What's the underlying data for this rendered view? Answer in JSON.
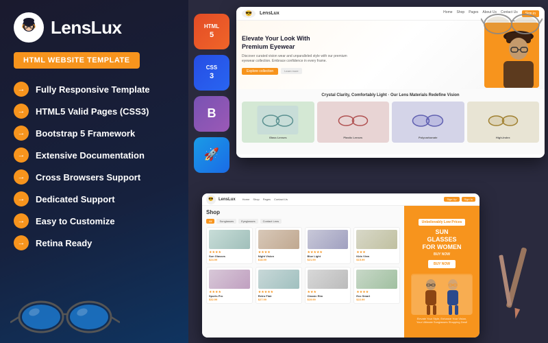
{
  "brand": {
    "name": "LensLux",
    "logo_char": "😎"
  },
  "badge": {
    "label": "HTML WEBSITE TEMPLATE"
  },
  "features": [
    {
      "id": "responsive",
      "text": "Fully Responsive Template"
    },
    {
      "id": "html5",
      "text": "HTML5 Valid Pages (CSS3)"
    },
    {
      "id": "bootstrap",
      "text": "Bootstrap 5 Framework"
    },
    {
      "id": "docs",
      "text": "Extensive Documentation"
    },
    {
      "id": "crossbrowser",
      "text": "Cross Browsers Support"
    },
    {
      "id": "support",
      "text": "Dedicated Support"
    },
    {
      "id": "customize",
      "text": "Easy to Customize"
    },
    {
      "id": "retina",
      "text": "Retina Ready"
    }
  ],
  "tech_badges": [
    {
      "id": "html5",
      "label": "HTML\n5",
      "class": "tech-html"
    },
    {
      "id": "css3",
      "label": "CSS\n3",
      "class": "tech-css"
    },
    {
      "id": "bootstrap5",
      "label": "B",
      "class": "tech-bootstrap"
    },
    {
      "id": "rocket",
      "label": "🚀",
      "class": "tech-rocket"
    }
  ],
  "mockup_top": {
    "nav": {
      "logo": "LensLux",
      "links": [
        "Home",
        "Shop",
        "Pages",
        "About Us",
        "Contact Us"
      ],
      "btn_label": "Sign in"
    },
    "hero": {
      "title": "Elevate Your Look With\nPremium Eyewear",
      "subtitle": "Discover curated vision wear and unparalleled style with our premium eyewear collection. Embrace confidence in every frame.",
      "btn_label": "Explore collection"
    },
    "products_title": "Crystal Clarity, Comfortably Light - Our Lens\nMaterials Redefine Vision",
    "product_labels": [
      "Glass Lenses",
      "Plastic Lenses",
      "Polycarbonate Lenses",
      "High-Index Lenses"
    ]
  },
  "mockup_bottom": {
    "nav": {
      "logo": "LensLux",
      "links": [
        "Home",
        "Shop",
        "Pages",
        "Contact Us"
      ],
      "btn1": "Sign Up",
      "btn2": "Sign In"
    },
    "shop_title": "Shop",
    "filters": [
      "All",
      "Sunglasses",
      "Eyeglasses",
      "Contact Lens"
    ],
    "items": [
      {
        "name": "Sun Glasses",
        "price": "$24.99",
        "stars": "★★★★"
      },
      {
        "name": "Night Vision",
        "price": "$18.99",
        "stars": "★★★★"
      },
      {
        "name": "Blue Light",
        "price": "$21.99",
        "stars": "★★★★★"
      },
      {
        "name": "Kids View",
        "price": "$15.99",
        "stars": "★★★"
      },
      {
        "name": "Sports Pro",
        "price": "$32.99",
        "stars": "★★★★"
      },
      {
        "name": "Retro Flair",
        "price": "$27.99",
        "stars": "★★★★★"
      },
      {
        "name": "Classic Rim",
        "price": "$19.99",
        "stars": "★★★"
      },
      {
        "name": "Eco Smart",
        "price": "$22.99",
        "stars": "★★★★"
      }
    ],
    "ad": {
      "badge": "Unbelievably Low Prices",
      "title": "SUN\nGLASSES\nFOR WOMEN",
      "sub": "BUY NOW",
      "desc": "Elevate Your Style, Enhance Your Vision,\nYour Ultimate Sunglasses Shopping Dest!"
    }
  },
  "colors": {
    "orange": "#f7941d",
    "dark_bg": "#1a1a2e",
    "white": "#ffffff"
  }
}
